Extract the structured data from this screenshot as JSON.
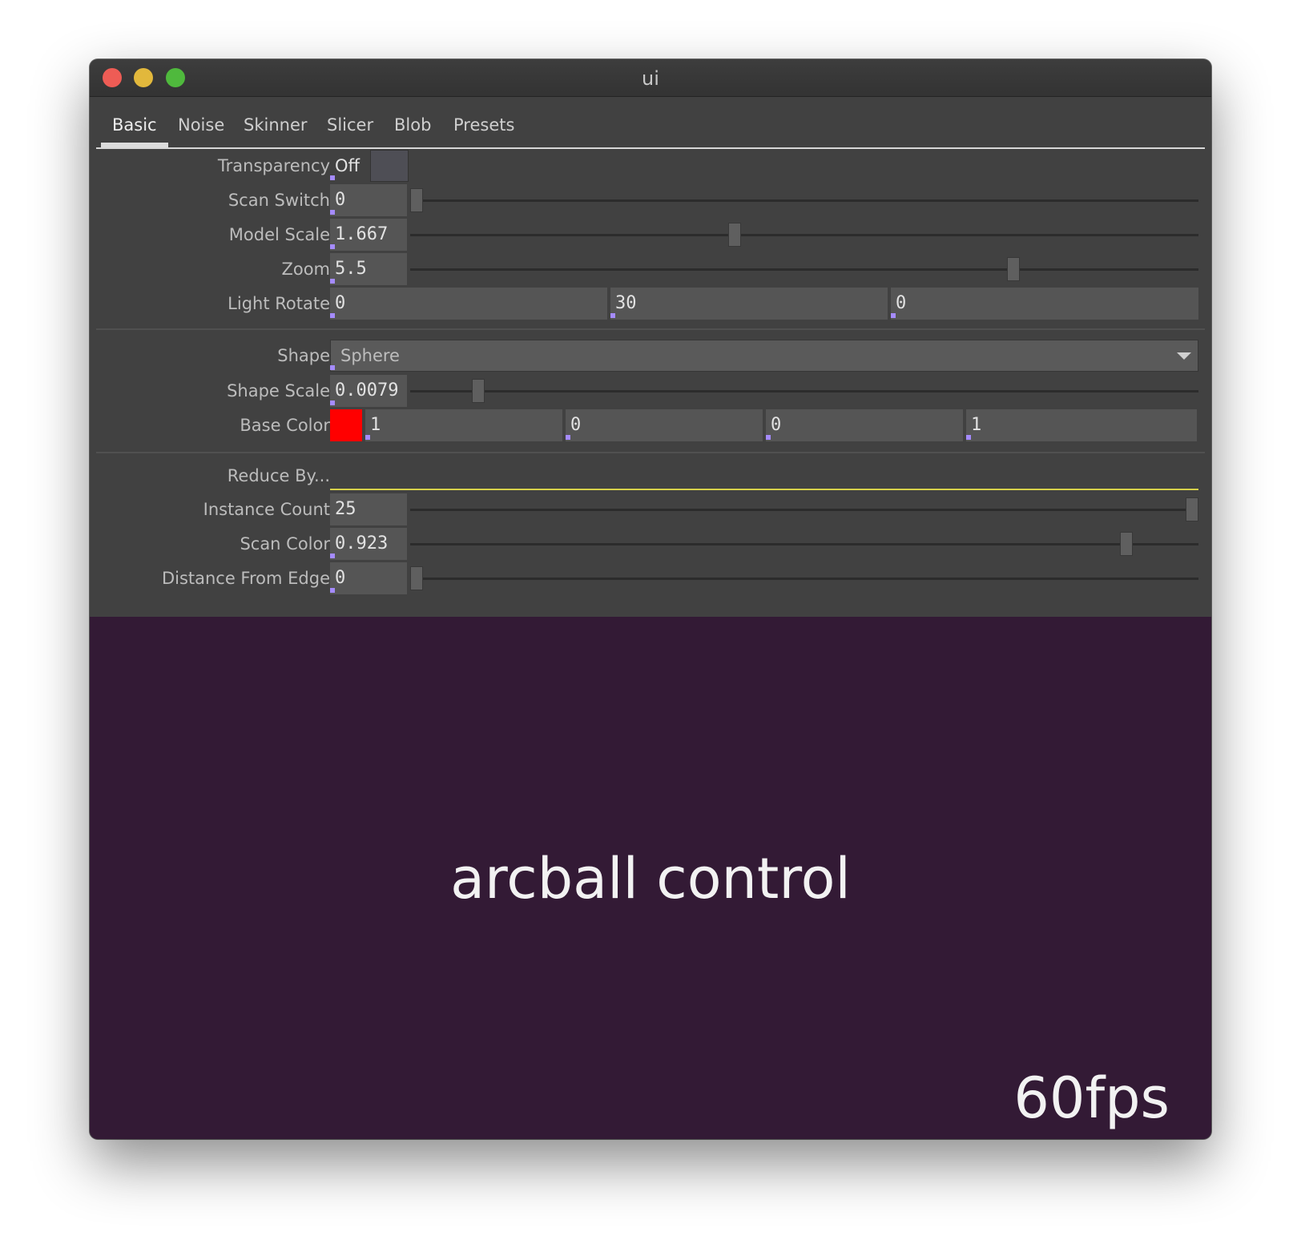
{
  "window": {
    "title": "ui"
  },
  "tabs": [
    "Basic",
    "Noise",
    "Skinner",
    "Slicer",
    "Blob",
    "Presets"
  ],
  "active_tab": "Basic",
  "transparency": {
    "label": "Transparency",
    "value": "Off"
  },
  "scan_switch": {
    "label": "Scan Switch",
    "value": "0",
    "slider_fraction": 0.0
  },
  "model_scale": {
    "label": "Model Scale",
    "value": "1.667",
    "slider_fraction": 0.41
  },
  "zoom": {
    "label": "Zoom",
    "value": "5.5",
    "slider_fraction": 0.77
  },
  "light_rotate": {
    "label": "Light Rotate",
    "values": [
      "0",
      "30",
      "0"
    ]
  },
  "shape": {
    "label": "Shape",
    "value": "Sphere"
  },
  "shape_scale": {
    "label": "Shape Scale",
    "value": "0.0079",
    "slider_fraction": 0.08
  },
  "base_color": {
    "label": "Base Color",
    "swatch": "#ff0000",
    "values": [
      "1",
      "0",
      "0",
      "1"
    ]
  },
  "reduce_by": {
    "label": "Reduce By..."
  },
  "instance_count": {
    "label": "Instance Count",
    "value": "25",
    "slider_fraction": 1.0
  },
  "scan_color": {
    "label": "Scan Color",
    "value": "0.923",
    "slider_fraction": 0.915
  },
  "distance_from_edge": {
    "label": "Distance From Edge",
    "value": "0",
    "slider_fraction": 0.0
  },
  "viewport": {
    "text": "arcball control",
    "fps": "60fps"
  },
  "colors": {
    "panel": "#414141",
    "field": "#555555",
    "viewport_bg": "#331a35",
    "accent_line": "#d6d04a",
    "marker": "#a58bff"
  }
}
